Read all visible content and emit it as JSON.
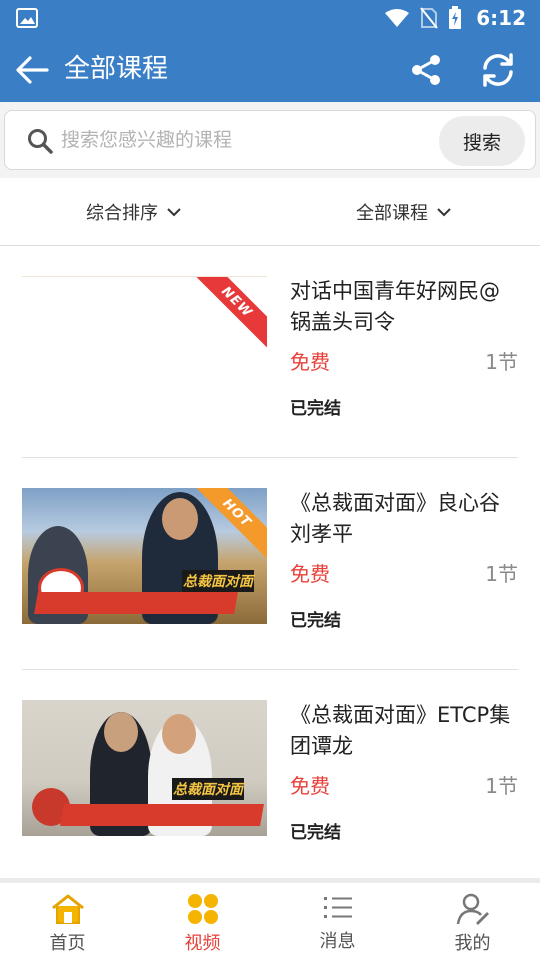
{
  "status_bar": {
    "time": "6:12",
    "icons": [
      "photo-icon",
      "wifi-icon",
      "no-sim-icon",
      "battery-icon"
    ]
  },
  "app_bar": {
    "title": "全部课程",
    "icons": [
      "back-arrow-icon",
      "share-icon",
      "refresh-icon"
    ]
  },
  "search": {
    "placeholder": "搜索您感兴趣的课程",
    "value": "",
    "button_label": "搜索"
  },
  "filters": {
    "sort_label": "综合排序",
    "category_label": "全部课程"
  },
  "courses": [
    {
      "title": "对话中国青年好网民@锅盖头司令",
      "price": "免费",
      "lessons": "1节",
      "status": "已完结",
      "ribbon": "NEW"
    },
    {
      "title": "《总裁面对面》良心谷刘孝平",
      "price": "免费",
      "lessons": "1节",
      "status": "已完结",
      "ribbon": "HOT"
    },
    {
      "title": "《总裁面对面》ETCP集团谭龙",
      "price": "免费",
      "lessons": "1节",
      "status": "已完结",
      "ribbon": ""
    }
  ],
  "bottom_nav": {
    "items": [
      {
        "label": "首页",
        "icon": "home-icon"
      },
      {
        "label": "视频",
        "icon": "video-grid-icon"
      },
      {
        "label": "消息",
        "icon": "list-icon"
      },
      {
        "label": "我的",
        "icon": "profile-icon"
      }
    ],
    "active_index": 1
  },
  "colors": {
    "primary": "#3a7fc6",
    "price": "#e8413a",
    "active_nav": "#e8413a",
    "hot": "#f39a2b",
    "new": "#e8393a",
    "home_icon": "#f5b400"
  }
}
